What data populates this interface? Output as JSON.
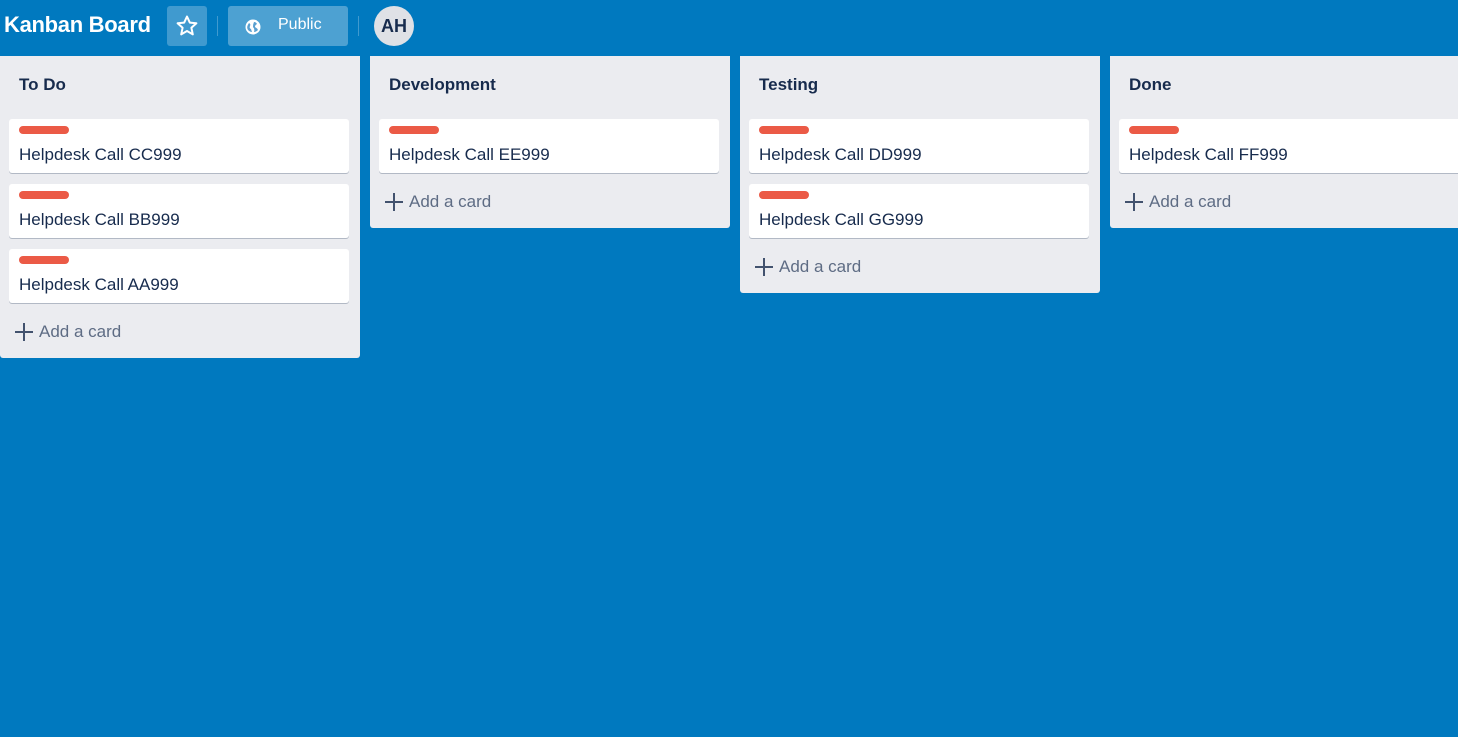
{
  "header": {
    "title": "Kanban Board",
    "visibility_label": "Public",
    "avatar_initials": "AH"
  },
  "add_card_label": "Add a card",
  "colors": {
    "board_background": "#0079bf",
    "list_background": "#ebecf0",
    "label_red": "#eb5a46"
  },
  "lists": [
    {
      "title": "To Do",
      "cards": [
        {
          "title": "Helpdesk Call CC999",
          "label_color": "red"
        },
        {
          "title": "Helpdesk Call BB999",
          "label_color": "red"
        },
        {
          "title": "Helpdesk Call AA999",
          "label_color": "red"
        }
      ]
    },
    {
      "title": "Development",
      "cards": [
        {
          "title": "Helpdesk Call EE999",
          "label_color": "red"
        }
      ]
    },
    {
      "title": "Testing",
      "cards": [
        {
          "title": "Helpdesk Call DD999",
          "label_color": "red"
        },
        {
          "title": "Helpdesk Call GG999",
          "label_color": "red"
        }
      ]
    },
    {
      "title": "Done",
      "cards": [
        {
          "title": "Helpdesk Call FF999",
          "label_color": "red"
        }
      ]
    }
  ]
}
